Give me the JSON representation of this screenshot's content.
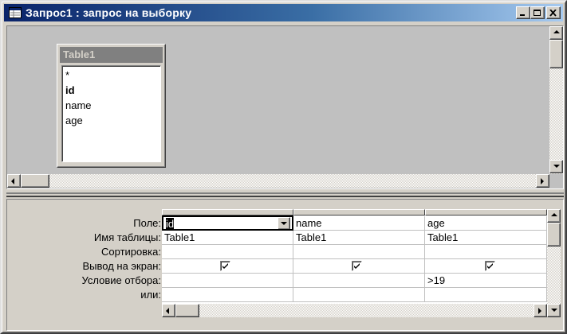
{
  "window": {
    "title": "Запрос1 : запрос на выборку",
    "icon": "query-icon"
  },
  "table": {
    "name": "Table1",
    "fields": [
      "*",
      "id",
      "name",
      "age"
    ],
    "bold_field": "id"
  },
  "grid": {
    "row_labels": [
      "Поле:",
      "Имя таблицы:",
      "Сортировка:",
      "Вывод на экран:",
      "Условие отбора:",
      "или:"
    ],
    "columns": [
      {
        "field": "id",
        "table": "Table1",
        "sort": "",
        "show": true,
        "criteria": "",
        "or": ""
      },
      {
        "field": "name",
        "table": "Table1",
        "sort": "",
        "show": true,
        "criteria": "",
        "or": ""
      },
      {
        "field": "age",
        "table": "Table1",
        "sort": "",
        "show": true,
        "criteria": ">19",
        "or": ""
      }
    ]
  },
  "colors": {
    "title_start": "#0a246a",
    "title_end": "#a6caf0",
    "face": "#d4d0c8"
  }
}
